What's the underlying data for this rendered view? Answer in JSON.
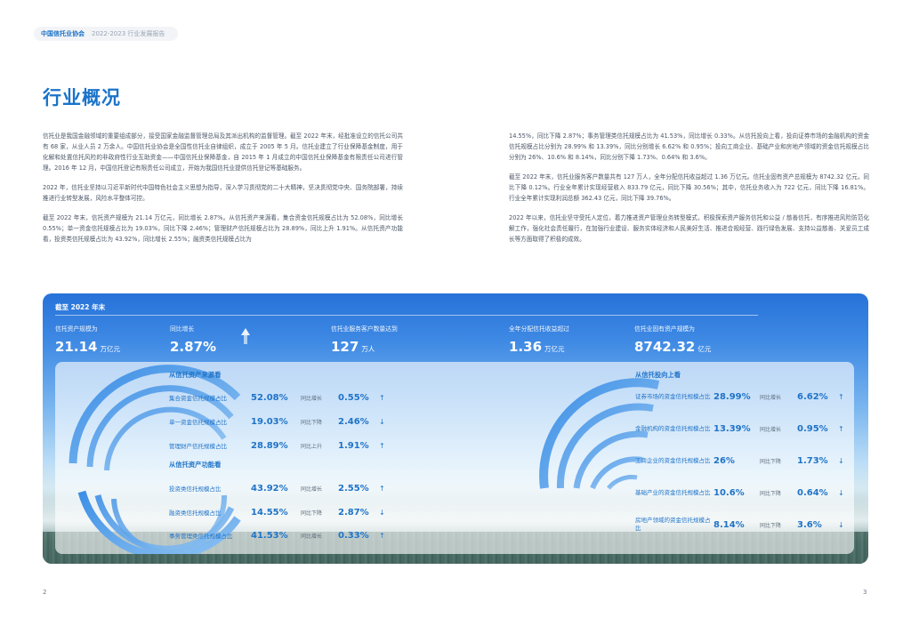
{
  "header": {
    "org": "中国信托业协会",
    "report": "2022-2023 行业发展报告"
  },
  "page_title": "行业概况",
  "left_column": {
    "p1": "信托业是我国金融领域的重要组成部分，接受国家金融监督管理总局及其派出机构的监督管理。截至 2022 年末，经批准设立的信托公司共有 68 家，从业人员 2 万余人。中国信托业协会是全国性信托业自律组织，成立于 2005 年 5 月。信托业建立了行业保障基金制度，用于化解和处置信托风险的非政府性行业互助资金——中国信托业保障基金，自 2015 年 1 月成立的中国信托业保障基金有限责任公司进行管理。2016 年 12 月，中国信托登记有限责任公司成立，开始为我国信托业提供信托登记等基础服务。",
    "p2": "2022 年，信托业坚持以习近平新时代中国特色社会主义思想为指导，深入学习贯彻党的二十大精神，坚决贯彻党中央、国务院部署，持续推进行业转型发展，风险水平整体可控。",
    "p3": "截至 2022 年末，信托资产规模为 21.14 万亿元，同比增长 2.87%。从信托资产来源看，集合资金信托规模占比为 52.08%，同比增长 0.55%；单一资金信托规模占比为 19.03%，同比下降 2.46%；管理财产信托规模占比为 28.89%，同比上升 1.91%。从信托资产功能看，投资类信托规模占比为 43.92%，同比增长 2.55%；融资类信托规模占比为"
  },
  "right_column": {
    "p1": "14.55%，同比下降 2.87%；事务管理类信托规模占比为 41.53%，同比增长 0.33%。从信托投向上看，投向证券市场的金融机构的资金信托规模占比分别为 28.99% 和 13.39%，同比分别增长 6.62% 和 0.95%；投向工商企业、基础产业和房地产领域的资金信托规模占比分别为 26%、10.6% 和 8.14%，同比分别下降 1.73%、0.64% 和 3.6%。",
    "p2": "截至 2022 年末，信托业服务客户数量共有 127 万人，全年分配信托收益超过 1.36 万亿元。信托业固有资产总规模为 8742.32 亿元，同比下降 0.12%。行业全年累计实现经营收入 833.79 亿元，同比下降 30.56%；其中，信托业务收入为 722 亿元，同比下降 16.81%。行业全年累计实现利润总额 362.43 亿元，同比下降 39.76%。",
    "p3": "2022 年以来，信托业坚守受托人定位，着力推进资产管理业务转型模式，积极探索资产服务信托和公益 / 慈善信托，有序推进风险防范化解工作，强化社会责任履行，在加强行业建设、服务实体经济和人民美好生活、推进合规经营、践行绿色发展、支持公益慈善、关爱员工成长等方面取得了积极的成效。"
  },
  "panel": {
    "heading": "截至 2022 年末",
    "stats": [
      {
        "label": "信托资产规模为",
        "value": "21.14",
        "unit": "万亿元"
      },
      {
        "label": "同比增长",
        "value": "2.87%",
        "unit": ""
      },
      {
        "label": "信托业服务客户数量达到",
        "value": "127",
        "unit": "万人"
      },
      {
        "label": "全年分配信托收益超过",
        "value": "1.36",
        "unit": "万亿元"
      },
      {
        "label": "信托业固有资产规模为",
        "value": "8742.32",
        "unit": "亿元"
      }
    ],
    "source_title": "从信托资产来源看",
    "source_rows": [
      {
        "label": "集合资金信托规模占比",
        "value": "52.08%",
        "trend": "同比增长",
        "change": "0.55%",
        "arrow": "↑"
      },
      {
        "label": "单一资金信托规模占比",
        "value": "19.03%",
        "trend": "同比下降",
        "change": "2.46%",
        "arrow": "↓"
      },
      {
        "label": "管理财产信托规模占比",
        "value": "28.89%",
        "trend": "同比上升",
        "change": "1.91%",
        "arrow": "↑"
      }
    ],
    "function_title": "从信托资产功能看",
    "function_rows": [
      {
        "label": "投资类信托规模占比",
        "value": "43.92%",
        "trend": "同比增长",
        "change": "2.55%",
        "arrow": "↑"
      },
      {
        "label": "融资类信托规模占比",
        "value": "14.55%",
        "trend": "同比下降",
        "change": "2.87%",
        "arrow": "↓"
      },
      {
        "label": "事务管理类信托规模占比",
        "value": "41.53%",
        "trend": "同比增长",
        "change": "0.33%",
        "arrow": "↑"
      }
    ],
    "direction_title": "从信托投向上看",
    "direction_rows": [
      {
        "label": "证券市场的资金信托规模占比",
        "value": "28.99%",
        "trend": "同比增长",
        "change": "6.62%",
        "arrow": "↑"
      },
      {
        "label": "金融机构的资金信托规模占比",
        "value": "13.39%",
        "trend": "同比增长",
        "change": "0.95%",
        "arrow": "↑"
      },
      {
        "label": "工商企业的资金信托规模占比",
        "value": "26%",
        "trend": "同比下降",
        "change": "1.73%",
        "arrow": "↓"
      },
      {
        "label": "基础产业的资金信托规模占比",
        "value": "10.6%",
        "trend": "同比下降",
        "change": "0.64%",
        "arrow": "↓"
      },
      {
        "label": "房地产领域的资金信托规模占比",
        "value": "8.14%",
        "trend": "同比下降",
        "change": "3.6%",
        "arrow": "↓"
      }
    ]
  },
  "page_numbers": {
    "left": "2",
    "right": "3"
  },
  "colors": {
    "accent": "#1f73c8",
    "title": "#1a73c9"
  }
}
